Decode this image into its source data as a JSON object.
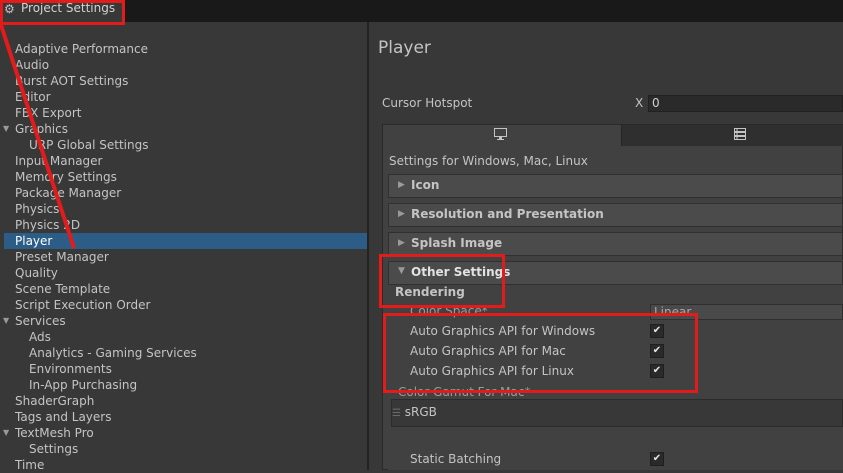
{
  "window": {
    "tab_title": "Project Settings",
    "tab_icon": "gear-icon"
  },
  "sidebar": {
    "items": [
      {
        "label": "Adaptive Performance"
      },
      {
        "label": "Audio"
      },
      {
        "label": "Burst AOT Settings"
      },
      {
        "label": "Editor"
      },
      {
        "label": "FBX Export"
      },
      {
        "label": "Graphics"
      },
      {
        "label": "URP Global Settings"
      },
      {
        "label": "Input Manager"
      },
      {
        "label": "Memory Settings"
      },
      {
        "label": "Package Manager"
      },
      {
        "label": "Physics"
      },
      {
        "label": "Physics 2D"
      },
      {
        "label": "Player"
      },
      {
        "label": "Preset Manager"
      },
      {
        "label": "Quality"
      },
      {
        "label": "Scene Template"
      },
      {
        "label": "Script Execution Order"
      },
      {
        "label": "Services"
      },
      {
        "label": "Ads"
      },
      {
        "label": "Analytics - Gaming Services"
      },
      {
        "label": "Environments"
      },
      {
        "label": "In-App Purchasing"
      },
      {
        "label": "ShaderGraph"
      },
      {
        "label": "Tags and Layers"
      },
      {
        "label": "TextMesh Pro"
      },
      {
        "label": "Settings"
      },
      {
        "label": "Time"
      }
    ],
    "selected": "Player"
  },
  "main": {
    "title": "Player",
    "cursor_hotspot": {
      "label": "Cursor Hotspot",
      "x_label": "X",
      "x_value": "0"
    },
    "platform_caption": "Settings for Windows, Mac, Linux",
    "sections": {
      "icon": "Icon",
      "resolution": "Resolution and Presentation",
      "splash": "Splash Image",
      "other": "Other Settings"
    },
    "rendering_header": "Rendering",
    "color_space": {
      "label": "Color Space*",
      "value": "Linear"
    },
    "auto_api": [
      {
        "label": "Auto Graphics API  for Windows",
        "checked": true
      },
      {
        "label": "Auto Graphics API  for Mac",
        "checked": true
      },
      {
        "label": "Auto Graphics API  for Linux",
        "checked": true
      }
    ],
    "color_gamut": {
      "label": "Color Gamut For Mac*",
      "item": "sRGB"
    },
    "static_batching": {
      "label": "Static Batching",
      "checked": true
    }
  },
  "colors": {
    "selection": "#2c5d87",
    "annotation": "#e21b1b",
    "background": "#383838"
  }
}
